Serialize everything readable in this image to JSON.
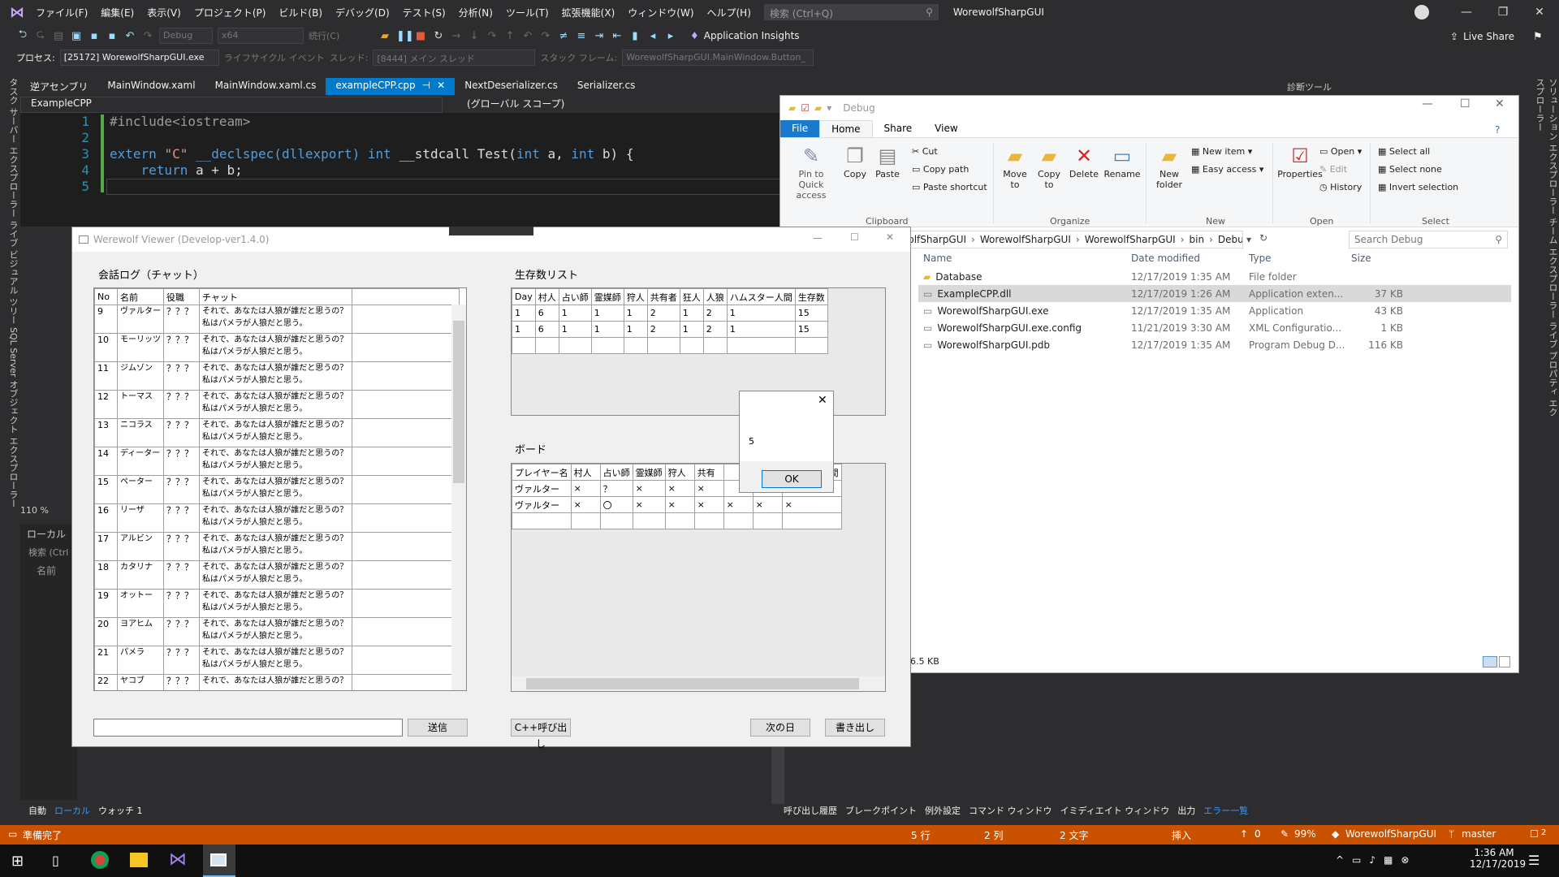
{
  "vs": {
    "menu": [
      "ファイル(F)",
      "編集(E)",
      "表示(V)",
      "プロジェクト(P)",
      "ビルド(B)",
      "デバッグ(D)",
      "テスト(S)",
      "分析(N)",
      "ツール(T)",
      "拡張機能(X)",
      "ウィンドウ(W)",
      "ヘルプ(H)"
    ],
    "search_placeholder": "検索 (Ctrl+Q)",
    "title": "WorewolfSharpGUI",
    "toolbar": {
      "config": "Debug",
      "platform": "x64",
      "continue": "続行(C)",
      "insights": "Application Insights",
      "live_share": "Live Share"
    },
    "process_label": "プロセス:",
    "process": "[25172] WorewolfSharpGUI.exe",
    "lifecycle": "ライフサイクル イベント",
    "thread_label": "スレッド:",
    "thread": "[8444] メイン スレッド",
    "stack_label": "スタック フレーム:",
    "stack": "WorewolfSharpGUI.MainWindow.Button_",
    "tabs": [
      "逆アセンブリ",
      "MainWindow.xaml",
      "MainWindow.xaml.cs",
      "exampleCPP.cpp",
      "NextDeserializer.cs",
      "Serializer.cs"
    ],
    "active_tab": "exampleCPP.cpp",
    "diag_tab": "診断ツール",
    "nav_project": "ExampleCPP",
    "nav_scope": "(グローバル スコープ)",
    "code": {
      "l1": "#include<iostream>",
      "l3a": "extern ",
      "l3b": "\"C\"",
      "l3c": " __declspec(dllexport) ",
      "l3d": "int",
      "l3e": " __stdcall Test(",
      "l3f": "int",
      "l3g": " a, ",
      "l3h": "int",
      "l3i": " b) {",
      "l4a": "    ",
      "l4b": "return",
      "l4c": " a + b;"
    },
    "line_numbers": [
      "1",
      "2",
      "3",
      "4",
      "5"
    ],
    "left_tools": "タスク  サーバー エクスプローラー  ライブ ビジュアル ツリー  SQL Server オブジェクト エクスプローラー",
    "right_tools": "ソリューション エクスプローラー  チーム エクスプローラー  ライブ プロパティ エクスプローラー",
    "zoom": "110 %",
    "locals_title": "ローカル",
    "locals_search": "検索 (Ctrl",
    "locals_col": "名前",
    "bottom_tabs_left": [
      "自動",
      "ローカル",
      "ウォッチ 1"
    ],
    "bottom_tabs_right": [
      "呼び出し履歴",
      "ブレークポイント",
      "例外設定",
      "コマンド ウィンドウ",
      "イミディエイト ウィンドウ",
      "出力",
      "エラー一覧"
    ],
    "status": {
      "ready": "準備完了",
      "line": "5 行",
      "col": "2 列",
      "chars": "2 文字",
      "ins": "挿入",
      "up": "0",
      "pct": "99%",
      "repo": "WorewolfSharpGUI",
      "branch": "master",
      "notif": "2"
    },
    "clock": {
      "time": "1:36 AM",
      "date": "12/17/2019"
    }
  },
  "explorer": {
    "title": "Debug",
    "ribbon_tabs": [
      "File",
      "Home",
      "Share",
      "View"
    ],
    "clipboard": {
      "pin": "Pin to Quick access",
      "copy": "Copy",
      "paste": "Paste",
      "cut": "Cut",
      "copy_path": "Copy path",
      "paste_shortcut": "Paste shortcut",
      "group": "Clipboard"
    },
    "organize": {
      "move": "Move to",
      "copy": "Copy to",
      "delete": "Delete",
      "rename": "Rename",
      "group": "Organize"
    },
    "new": {
      "folder": "New folder",
      "item": "New item",
      "easy": "Easy access",
      "group": "New"
    },
    "open": {
      "props": "Properties",
      "open": "Open",
      "edit": "Edit",
      "history": "History",
      "group": "Open"
    },
    "select": {
      "all": "Select all",
      "none": "Select none",
      "invert": "Invert selection",
      "group": "Select"
    },
    "crumbs": [
      "WorewolfSharpGUI",
      "WorewolfSharpGUI",
      "WorewolfSharpGUI",
      "bin",
      "Debug"
    ],
    "search_placeholder": "Search Debug",
    "columns": [
      "Name",
      "Date modified",
      "Type",
      "Size"
    ],
    "files": [
      {
        "name": "Database",
        "date": "12/17/2019 1:35 AM",
        "type": "File folder",
        "size": ""
      },
      {
        "name": "ExampleCPP.dll",
        "date": "12/17/2019 1:26 AM",
        "type": "Application exten...",
        "size": "37 KB"
      },
      {
        "name": "WorewolfSharpGUI.exe",
        "date": "12/17/2019 1:35 AM",
        "type": "Application",
        "size": "43 KB"
      },
      {
        "name": "WorewolfSharpGUI.exe.config",
        "date": "11/21/2019 3:30 AM",
        "type": "XML Configuratio...",
        "size": "1 KB"
      },
      {
        "name": "WorewolfSharpGUI.pdb",
        "date": "12/17/2019 1:35 AM",
        "type": "Program Debug D...",
        "size": "116 KB"
      }
    ],
    "status": "6.5 KB"
  },
  "werewolf": {
    "title": "Werewolf Viewer (Develop-ver1.4.0)",
    "chat_label": "会話ログ（チャット）",
    "chat_cols": [
      "No",
      "名前",
      "役職",
      "チャット"
    ],
    "chat_rows": [
      {
        "no": "9",
        "name": "ヴァルター",
        "role": "？？？",
        "t1": "それで、あなたは人狼が誰だと思うの？",
        "t2": "私はパメラが人狼だと思う。"
      },
      {
        "no": "10",
        "name": "モーリッツ",
        "role": "？？？",
        "t1": "それで、あなたは人狼が誰だと思うの？",
        "t2": "私はパメラが人狼だと思う。"
      },
      {
        "no": "11",
        "name": "ジムゾン",
        "role": "？？？",
        "t1": "それで、あなたは人狼が誰だと思うの？",
        "t2": "私はパメラが人狼だと思う。"
      },
      {
        "no": "12",
        "name": "トーマス",
        "role": "？？？",
        "t1": "それで、あなたは人狼が誰だと思うの？",
        "t2": "私はパメラが人狼だと思う。"
      },
      {
        "no": "13",
        "name": "ニコラス",
        "role": "？？？",
        "t1": "それで、あなたは人狼が誰だと思うの？",
        "t2": "私はパメラが人狼だと思う。"
      },
      {
        "no": "14",
        "name": "ディーター",
        "role": "？？？",
        "t1": "それで、あなたは人狼が誰だと思うの？",
        "t2": "私はパメラが人狼だと思う。"
      },
      {
        "no": "15",
        "name": "ペーター",
        "role": "？？？",
        "t1": "それで、あなたは人狼が誰だと思うの？",
        "t2": "私はパメラが人狼だと思う。"
      },
      {
        "no": "16",
        "name": "リーザ",
        "role": "？？？",
        "t1": "それで、あなたは人狼が誰だと思うの？",
        "t2": "私はパメラが人狼だと思う。"
      },
      {
        "no": "17",
        "name": "アルビン",
        "role": "？？？",
        "t1": "それで、あなたは人狼が誰だと思うの？",
        "t2": "私はパメラが人狼だと思う。"
      },
      {
        "no": "18",
        "name": "カタリナ",
        "role": "？？？",
        "t1": "それで、あなたは人狼が誰だと思うの？",
        "t2": "私はパメラが人狼だと思う。"
      },
      {
        "no": "19",
        "name": "オットー",
        "role": "？？？",
        "t1": "それで、あなたは人狼が誰だと思うの？",
        "t2": "私はパメラが人狼だと思う。"
      },
      {
        "no": "20",
        "name": "ヨアヒム",
        "role": "？？？",
        "t1": "それで、あなたは人狼が誰だと思うの？",
        "t2": "私はパメラが人狼だと思う。"
      },
      {
        "no": "21",
        "name": "パメラ",
        "role": "？？？",
        "t1": "それで、あなたは人狼が誰だと思うの？",
        "t2": "私はパメラが人狼だと思う。"
      },
      {
        "no": "22",
        "name": "ヤコブ",
        "role": "？？？",
        "t1": "それで、あなたは人狼が誰だと思うの？",
        "t2": ""
      }
    ],
    "survivor_label": "生存数リスト",
    "survivor_cols": [
      "Day",
      "村人",
      "占い師",
      "霊媒師",
      "狩人",
      "共有者",
      "狂人",
      "人狼",
      "ハムスター人間",
      "生存数"
    ],
    "survivor_rows": [
      [
        "1",
        "6",
        "1",
        "1",
        "1",
        "2",
        "1",
        "2",
        "1",
        "15"
      ],
      [
        "1",
        "6",
        "1",
        "1",
        "1",
        "2",
        "1",
        "2",
        "1",
        "15"
      ]
    ],
    "board_label": "ボード",
    "board_cols": [
      "プレイヤー名",
      "村人",
      "占い師",
      "霊媒師",
      "狩人",
      "共有",
      "",
      "",
      "ムスター人間"
    ],
    "board_rows": [
      [
        "ヴァルター",
        "×",
        "？",
        "×",
        "×",
        "×",
        "",
        "",
        ""
      ],
      [
        "ヴァルター",
        "×",
        "〇",
        "×",
        "×",
        "×",
        "×",
        "×",
        "×"
      ]
    ],
    "send": "送信",
    "cpp_call": "C++呼び出し",
    "next_day": "次の日",
    "export": "書き出し"
  },
  "msgbox": {
    "text": "5",
    "ok": "OK"
  }
}
